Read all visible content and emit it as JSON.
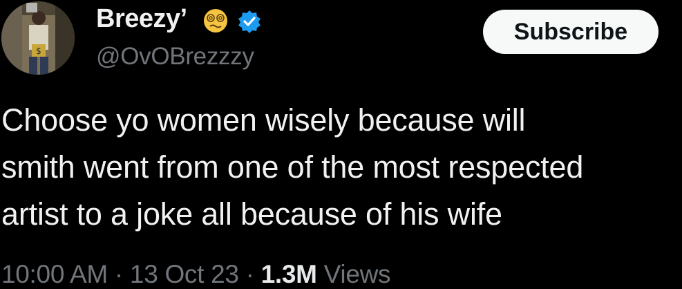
{
  "author": {
    "display_name": "Breezy’",
    "handle": "@OvOBrezzzy",
    "emoji": "dizzy-face-emoji",
    "verified": true
  },
  "actions": {
    "subscribe_label": "Subscribe"
  },
  "tweet": {
    "lines": [
      "Choose yo women wisely because will",
      "smith went from one of the most respected",
      "artist to a joke all because of his wife"
    ]
  },
  "meta": {
    "time": "10:00 AM",
    "separator": " · ",
    "date": "13 Oct 23",
    "views_count": "1.3M",
    "views_label": " Views"
  },
  "colors": {
    "background": "#000000",
    "text": "#e7e9ea",
    "muted": "#71767b",
    "verified": "#1d9bf0",
    "button_bg": "#f7f9f9"
  }
}
